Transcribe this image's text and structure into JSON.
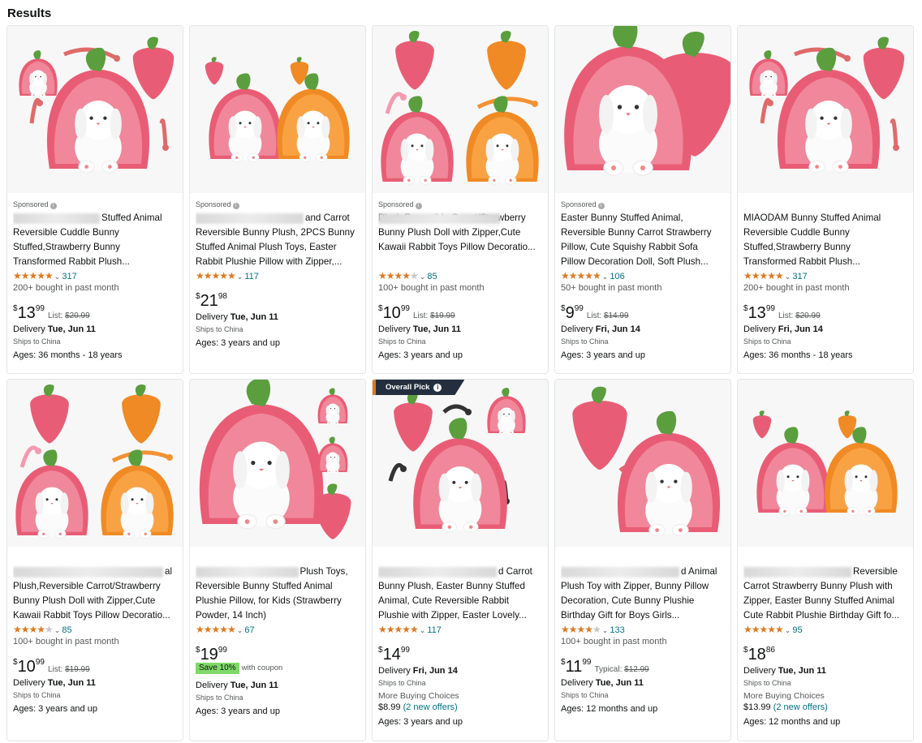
{
  "page": {
    "heading": "Results"
  },
  "colors": {
    "star": "#de7921",
    "link": "#007185",
    "badge_bg": "#232f3e",
    "coupon_bg": "#7fda69",
    "strawberry": "#e85d75",
    "carrot": "#f08a24",
    "leaf": "#5a9e3e"
  },
  "products": [
    {
      "sponsored": "Sponsored",
      "image": "strawberry-bunny-arrows",
      "badge": "",
      "title_lines": [
        "Stuffed Animal",
        "Reversible Cuddle Bunny",
        "Stuffed,Strawberry Bunny",
        "Transformed Rabbit Plush..."
      ],
      "title_blur_first_line": true,
      "rating": 4.5,
      "reviews": "317",
      "bought": "200+ bought in past month",
      "price_whole": "13",
      "price_frac": "99",
      "list_label": "List:",
      "list_price": "$20.99",
      "coupon": "",
      "coupon_note": "",
      "delivery_label": "Delivery",
      "delivery_date": "Tue, Jun 11",
      "ships": "Ships to China",
      "more_choices": "",
      "offer_price": "",
      "offer_link": "",
      "ages": "Ages: 36 months - 18 years"
    },
    {
      "sponsored": "Sponsored",
      "image": "two-bunnies",
      "badge": "",
      "title_lines": [
        "and Carrot",
        "Reversible Bunny Plush, 2PCS Bunny",
        "Stuffed Animal Plush Toys, Easter",
        "Rabbit Plushie Pillow with Zipper,..."
      ],
      "title_blur_first_line": true,
      "rating": 4.5,
      "reviews": "117",
      "bought": "",
      "price_whole": "21",
      "price_frac": "98",
      "list_label": "",
      "list_price": "",
      "coupon": "",
      "coupon_note": "",
      "delivery_label": "Delivery",
      "delivery_date": "Tue, Jun 11",
      "ships": "Ships to China",
      "more_choices": "",
      "offer_price": "",
      "offer_link": "",
      "ages": "Ages: 3 years and up"
    },
    {
      "sponsored": "Sponsored",
      "image": "strawberry-carrot-arrows",
      "badge": "",
      "title_lines": [
        "",
        "Plush,Reversible Carrot/Strawberry",
        "Bunny Plush Doll with Zipper,Cute",
        "Kawaii Rabbit Toys Pillow Decoratio..."
      ],
      "title_blur_first_line": true,
      "rating": 4.0,
      "reviews": "85",
      "bought": "100+ bought in past month",
      "price_whole": "10",
      "price_frac": "99",
      "list_label": "List:",
      "list_price": "$19.99",
      "coupon": "",
      "coupon_note": "",
      "delivery_label": "Delivery",
      "delivery_date": "Tue, Jun 11",
      "ships": "Ships to China",
      "more_choices": "",
      "offer_price": "",
      "offer_link": "",
      "ages": "Ages: 3 years and up"
    },
    {
      "sponsored": "Sponsored",
      "image": "big-strawberry-bunny",
      "badge": "",
      "title_lines": [
        "Easter Bunny Stuffed Animal,",
        "Reversible Bunny Carrot Strawberry",
        "Pillow, Cute Squishy Rabbit Sofa",
        "Pillow Decoration Doll, Soft Plush..."
      ],
      "title_blur_first_line": false,
      "rating": 4.5,
      "reviews": "106",
      "bought": "50+ bought in past month",
      "price_whole": "9",
      "price_frac": "99",
      "list_label": "List:",
      "list_price": "$14.99",
      "coupon": "",
      "coupon_note": "",
      "delivery_label": "Delivery",
      "delivery_date": "Fri, Jun 14",
      "ships": "Ships to China",
      "more_choices": "",
      "offer_price": "",
      "offer_link": "",
      "ages": "Ages: 3 years and up"
    },
    {
      "sponsored": "",
      "image": "strawberry-bunny-arrows",
      "badge": "",
      "title_lines": [
        "MIAODAM Bunny Stuffed Animal",
        "Reversible Cuddle Bunny",
        "Stuffed,Strawberry Bunny",
        "Transformed Rabbit Plush..."
      ],
      "title_blur_first_line": false,
      "rating": 4.5,
      "reviews": "317",
      "bought": "200+ bought in past month",
      "price_whole": "13",
      "price_frac": "99",
      "list_label": "List:",
      "list_price": "$20.99",
      "coupon": "",
      "coupon_note": "",
      "delivery_label": "Delivery",
      "delivery_date": "Fri, Jun 14",
      "ships": "Ships to China",
      "more_choices": "",
      "offer_price": "",
      "offer_link": "",
      "ages": "Ages: 36 months - 18 years"
    },
    {
      "sponsored": "",
      "image": "strawberry-carrot-arrows",
      "badge": "",
      "title_lines": [
        "al",
        "Plush,Reversible Carrot/Strawberry",
        "Bunny Plush Doll with Zipper,Cute",
        "Kawaii Rabbit Toys Pillow Decoratio..."
      ],
      "title_blur_first_line": true,
      "rating": 4.0,
      "reviews": "85",
      "bought": "100+ bought in past month",
      "price_whole": "10",
      "price_frac": "99",
      "list_label": "List:",
      "list_price": "$19.99",
      "coupon": "",
      "coupon_note": "",
      "delivery_label": "Delivery",
      "delivery_date": "Tue, Jun 11",
      "ships": "Ships to China",
      "more_choices": "",
      "offer_price": "",
      "offer_link": "",
      "ages": "Ages: 3 years and up"
    },
    {
      "sponsored": "",
      "image": "big-strawberry-with-minis",
      "badge": "",
      "title_lines": [
        "Plush Toys,",
        "Reversible Bunny Stuffed Animal",
        "Plushie Pillow, for Kids (Strawberry",
        "Powder, 14 Inch)"
      ],
      "title_blur_first_line": true,
      "rating": 4.5,
      "reviews": "67",
      "bought": "",
      "price_whole": "19",
      "price_frac": "99",
      "list_label": "",
      "list_price": "",
      "coupon": "Save 10%",
      "coupon_note": "with coupon",
      "delivery_label": "Delivery",
      "delivery_date": "Tue, Jun 11",
      "ships": "Ships to China",
      "more_choices": "",
      "offer_price": "",
      "offer_link": "",
      "ages": "Ages: 3 years and up"
    },
    {
      "sponsored": "",
      "image": "strawberry-bunny-black-arrows",
      "badge": "Overall Pick",
      "title_lines": [
        "d Carrot",
        "Bunny Plush, Easter Bunny Stuffed",
        "Animal, Cute Reversible Rabbit",
        "Plushie with Zipper, Easter Lovely..."
      ],
      "title_blur_first_line": true,
      "rating": 4.5,
      "reviews": "117",
      "bought": "",
      "price_whole": "14",
      "price_frac": "99",
      "list_label": "",
      "list_price": "",
      "coupon": "",
      "coupon_note": "",
      "delivery_label": "Delivery",
      "delivery_date": "Fri, Jun 14",
      "ships": "Ships to China",
      "more_choices": "More Buying Choices",
      "offer_price": "$8.99",
      "offer_link": "(2 new offers)",
      "ages": "Ages: 3 years and up"
    },
    {
      "sponsored": "",
      "image": "strawberry-bunny-side",
      "badge": "",
      "title_lines": [
        "d Animal",
        "Plush Toy with Zipper, Bunny Pillow",
        "Decoration, Cute Bunny Plushie",
        "Birthday Gift for Boys Girls..."
      ],
      "title_blur_first_line": true,
      "rating": 4.0,
      "reviews": "133",
      "bought": "100+ bought in past month",
      "price_whole": "11",
      "price_frac": "99",
      "list_label": "Typical:",
      "list_price": "$12.99",
      "coupon": "",
      "coupon_note": "",
      "delivery_label": "Delivery",
      "delivery_date": "Tue, Jun 11",
      "ships": "Ships to China",
      "more_choices": "",
      "offer_price": "",
      "offer_link": "",
      "ages": "Ages: 12 months and up"
    },
    {
      "sponsored": "",
      "image": "two-bunnies",
      "badge": "",
      "title_lines": [
        "Reversible",
        "Carrot Strawberry Bunny Plush with",
        "Zipper, Easter Bunny Stuffed Animal",
        "Cute Rabbit Plushie Birthday Gift fo..."
      ],
      "title_blur_first_line": true,
      "rating": 4.5,
      "reviews": "95",
      "bought": "",
      "price_whole": "18",
      "price_frac": "86",
      "list_label": "",
      "list_price": "",
      "coupon": "",
      "coupon_note": "",
      "delivery_label": "Delivery",
      "delivery_date": "Tue, Jun 11",
      "ships": "Ships to China",
      "more_choices": "More Buying Choices",
      "offer_price": "$13.99",
      "offer_link": "(2 new offers)",
      "ages": "Ages: 12 months and up"
    }
  ]
}
